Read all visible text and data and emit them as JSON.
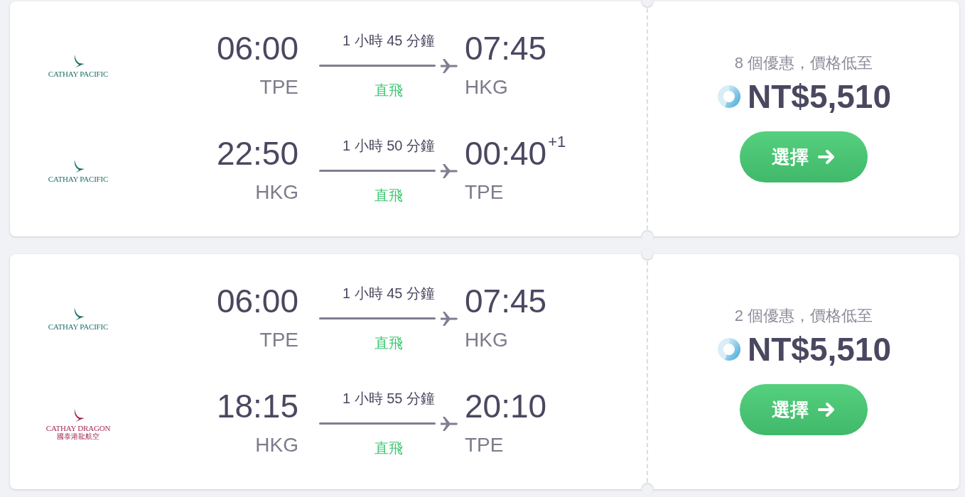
{
  "itineraries": [
    {
      "legs": [
        {
          "airline": {
            "kind": "pacific",
            "name": "CATHAY PACIFIC"
          },
          "depart_time": "06:00",
          "depart_airport": "TPE",
          "duration": "1 小時 45 分鐘",
          "stops": "直飛",
          "arrive_time": "07:45",
          "arrive_airport": "HKG"
        },
        {
          "airline": {
            "kind": "pacific",
            "name": "CATHAY PACIFIC"
          },
          "depart_time": "22:50",
          "depart_airport": "HKG",
          "duration": "1 小時 50 分鐘",
          "stops": "直飛",
          "arrive_time": "00:40",
          "day_offset": "+1",
          "arrive_airport": "TPE"
        }
      ],
      "offers": "8 個優惠，價格低至",
      "price": "NT$5,510",
      "button": "選擇"
    },
    {
      "legs": [
        {
          "airline": {
            "kind": "pacific",
            "name": "CATHAY PACIFIC"
          },
          "depart_time": "06:00",
          "depart_airport": "TPE",
          "duration": "1 小時 45 分鐘",
          "stops": "直飛",
          "arrive_time": "07:45",
          "arrive_airport": "HKG"
        },
        {
          "airline": {
            "kind": "dragon",
            "name": "CATHAY DRAGON",
            "name_local": "國泰港龍航空"
          },
          "depart_time": "18:15",
          "depart_airport": "HKG",
          "duration": "1 小時 55 分鐘",
          "stops": "直飛",
          "arrive_time": "20:10",
          "arrive_airport": "TPE"
        }
      ],
      "offers": "2 個優惠，價格低至",
      "price": "NT$5,510",
      "button": "選擇"
    }
  ]
}
